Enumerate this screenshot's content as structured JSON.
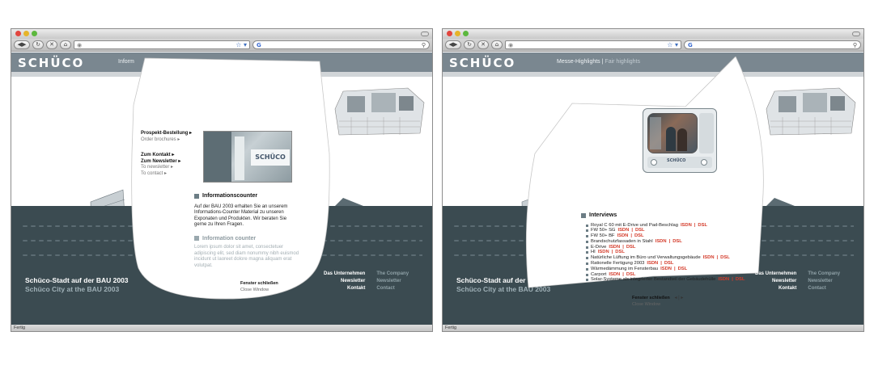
{
  "browser": {
    "status": "Fertig"
  },
  "site": {
    "logo": "SCHÜCO",
    "slogan_de": "Schüco-Stadt auf der BAU 2003",
    "slogan_en": "Schüco City at the BAU 2003",
    "footer_links": [
      {
        "de": "Das Unternehmen",
        "en": "The Company"
      },
      {
        "de": "Newsletter",
        "en": "Newsletter"
      },
      {
        "de": "Kontakt",
        "en": "Contact"
      }
    ]
  },
  "window1": {
    "nav_label": "Inform",
    "popup": {
      "links": [
        {
          "de": "Prospekt-Bestellung",
          "en": "Order brochures"
        },
        {
          "de": "Zum Kontakt",
          "en": ""
        },
        {
          "de": "Zum Newsletter",
          "en": "To newsletter"
        },
        {
          "de": "",
          "en": "To contact"
        }
      ],
      "image_brand": "SCHÜCO",
      "section_de_title": "Informationscounter",
      "section_de_body": "Auf der BAU 2003 erhalten Sie an unserem Informations-Counter Material zu unseren Exponaten und Produkten. Wir beraten Sie gerne zu Ihren Fragen.",
      "section_en_title": "Information counter",
      "section_en_body": "Lorem ipsum dolor sit amet, consectetuer adipiscing elit, sed diam nonummy nibh euismod incidunt ut laoreet dolore magna aliquam erat volutpat.",
      "close_de": "Fenster schließen",
      "close_en": "Close Window"
    }
  },
  "window2": {
    "nav_de": "Messe-Highlights",
    "nav_sep": "|",
    "nav_en": "Fair highlights",
    "popup": {
      "tv_brand": "SCHÜCO",
      "section_title": "Interviews",
      "items": [
        "Royal C 60 mit E-Drive und Pad-Beschlag",
        "FW 50+ SG",
        "FW 50+ BF",
        "Brandschutzfassaden in Stahl",
        "E-Drive",
        "HI",
        "Natürliche Lüftung im Büro und Verwaltungsgebäude",
        "Rationelle Fertigung 2003",
        "Wärmedämmung im Fensterbau",
        "Carport",
        "Solar-Systeme als integrierter Bestandteil der Gebäudehülle"
      ],
      "tag_isdn": "ISDN",
      "tag_sep": "|",
      "tag_dsl": "DSL",
      "close_de": "Fenster schließen",
      "close_en": "Close Window",
      "pager": "◂ | ▸"
    }
  }
}
